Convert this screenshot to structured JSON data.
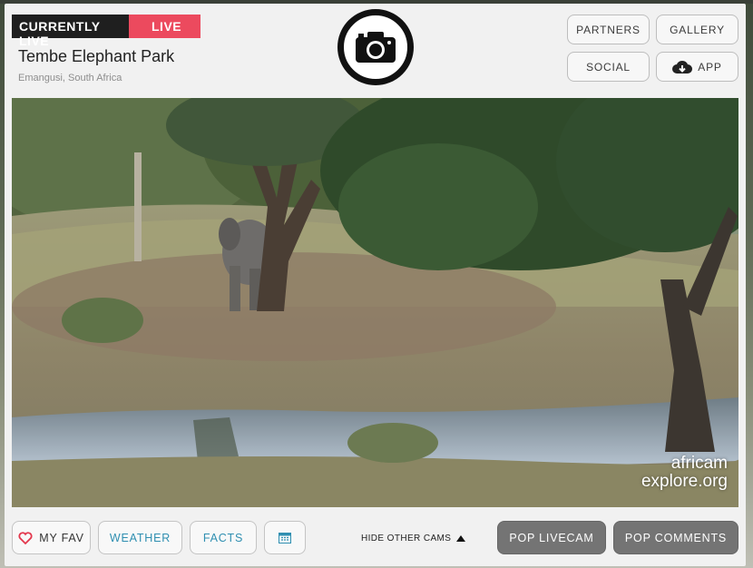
{
  "badge": {
    "currently": "CURRENTLY LIVE",
    "live": "LIVE"
  },
  "cam": {
    "title": "Tembe Elephant Park",
    "location": "Emangusi, South Africa"
  },
  "header_buttons": {
    "partners": "PARTNERS",
    "gallery": "GALLERY",
    "social": "SOCIAL",
    "app": "APP"
  },
  "watermark": {
    "line1": "africam",
    "line2": "explore.org"
  },
  "footer": {
    "my_fav": "MY FAV",
    "weather": "WEATHER",
    "facts": "FACTS",
    "hide_other_cams": "HIDE OTHER CAMS",
    "pop_livecam": "POP LIVECAM",
    "pop_comments": "POP COMMENTS"
  },
  "colors": {
    "live_red": "#ec4a5e",
    "link_blue": "#2f8fb1",
    "dark_button": "#747474"
  }
}
